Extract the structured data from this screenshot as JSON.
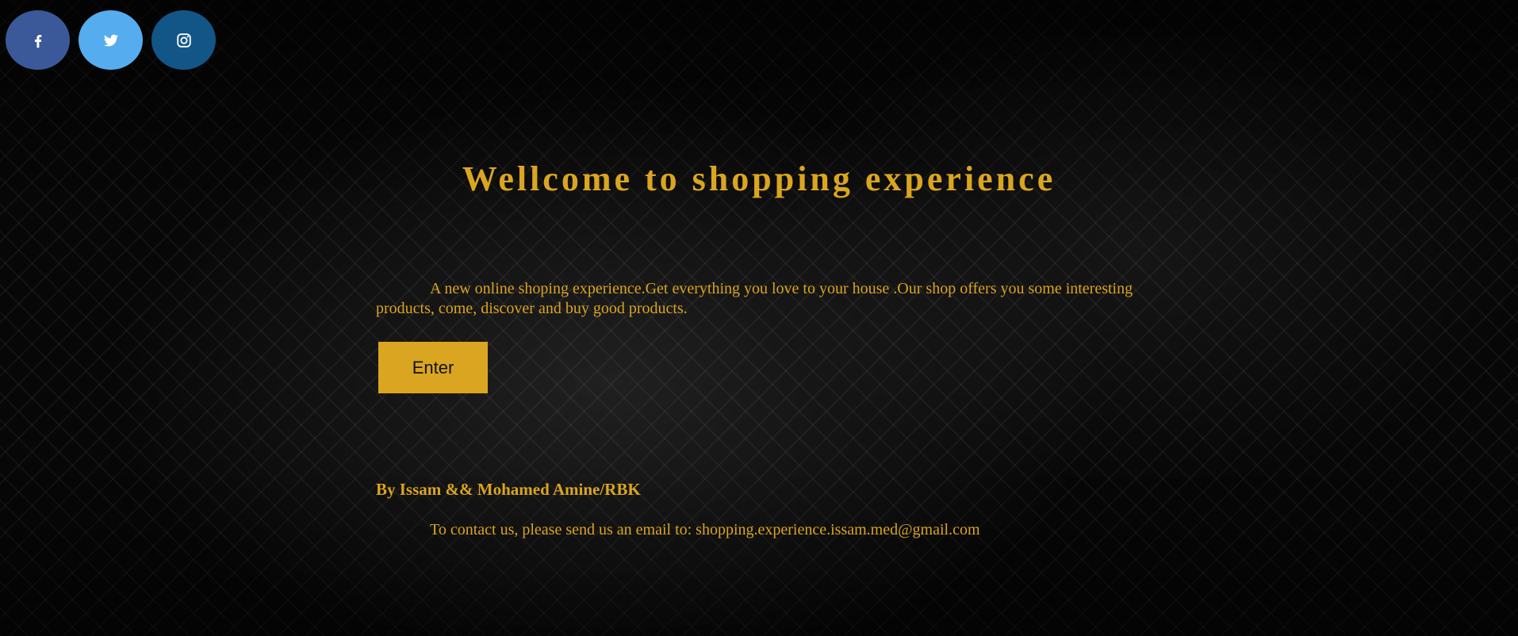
{
  "colors": {
    "accent": "#daa520",
    "facebook": "#3b5998",
    "twitter": "#55acee",
    "instagram": "#125688",
    "button_text": "#111111"
  },
  "social": [
    {
      "name": "facebook",
      "icon": "facebook-icon"
    },
    {
      "name": "twitter",
      "icon": "twitter-icon"
    },
    {
      "name": "instagram",
      "icon": "instagram-icon"
    }
  ],
  "hero": {
    "title": "Wellcome to shopping experience",
    "intro": "A new online shoping experience.Get everything you love to your house .Our shop offers you some interesting products, come, discover and buy good products.",
    "enter_label": "Enter"
  },
  "footer": {
    "byline": "By Issam && Mohamed Amine/RBK",
    "contact": "To contact us, please send us an email to: shopping.experience.issam.med@gmail.com"
  }
}
